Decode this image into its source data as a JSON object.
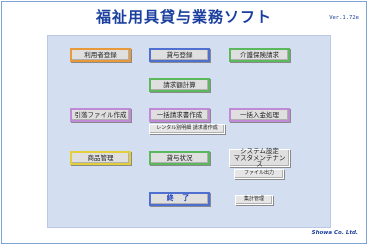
{
  "app": {
    "title": "福祉用具貸与業務ソフト",
    "version": "Ver.1.72e",
    "footer": "Showa Co. Ltd."
  },
  "buttons": {
    "user_registration": "利用者登録",
    "rental_registration": "貸与登録",
    "care_insurance_claim": "介護保険請求",
    "claim_amount_calc": "請求額計算",
    "withdrawal_file": "引落ファイル作成",
    "batch_invoice": "一括請求書作成",
    "rental_itemized_invoice": "レンタル別明細 請求書作成",
    "batch_payment": "一括入金処理",
    "product_management": "商品管理",
    "rental_status": "貸与状況",
    "system_settings_line1": "システム設定",
    "system_settings_line2": "マスタメンテナンス",
    "file_output": "ファイル出力",
    "exit": "終 了",
    "aggregate_management": "集計管理"
  },
  "colors": {
    "title": "#1a3f9e",
    "panel": "#d3dff0",
    "orange": "#e89a3a",
    "blue": "#4f6fd1",
    "green": "#5cb85c",
    "purple": "#c08ad6",
    "red": "#e26b6b",
    "yellow": "#e3cf3a"
  }
}
